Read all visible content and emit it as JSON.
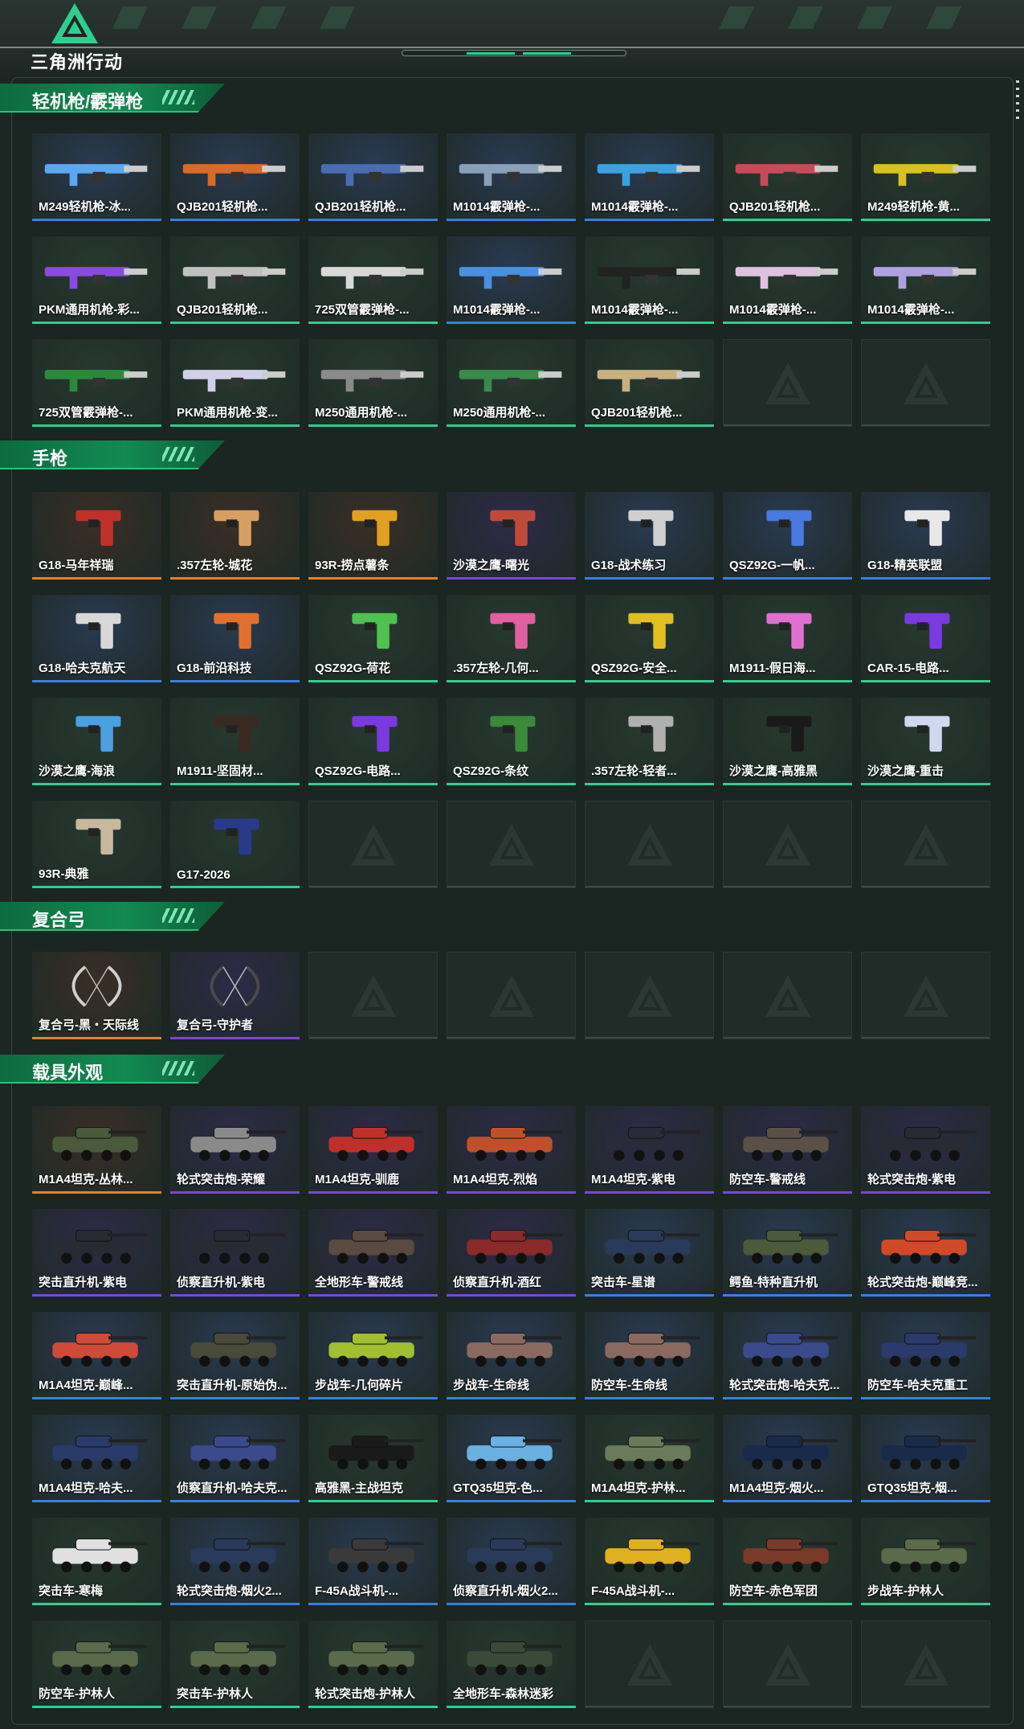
{
  "app": {
    "logo_text": "三角洲行动"
  },
  "colors": {
    "green": "#2ccf8f",
    "blue": "#3a7fe0",
    "purple": "#7a48d8",
    "orange": "#e8802a",
    "empty": "#3a4c45"
  },
  "sections": [
    {
      "title": "轻机枪/霰弹枪",
      "items": [
        {
          "label": "M249轻机枪-冰...",
          "rarity": "blue",
          "bg": "#2a3a52",
          "tint": "#5ba8f0"
        },
        {
          "label": "QJB201轻机枪...",
          "rarity": "blue",
          "bg": "#2a3a52",
          "tint": "#d86a2a"
        },
        {
          "label": "QJB201轻机枪...",
          "rarity": "blue",
          "bg": "#2a3a52",
          "tint": "#4a6db0"
        },
        {
          "label": "M1014霰弹枪-...",
          "rarity": "blue",
          "bg": "#2a3a52",
          "tint": "#8aa0b8"
        },
        {
          "label": "M1014霰弹枪-...",
          "rarity": "blue",
          "bg": "#2a3a52",
          "tint": "#3fa0e0"
        },
        {
          "label": "QJB201轻机枪...",
          "rarity": "green",
          "bg": "#27392f",
          "tint": "#c84a5a"
        },
        {
          "label": "M249轻机枪-黄...",
          "rarity": "green",
          "bg": "#27392f",
          "tint": "#d8c020"
        },
        {
          "label": "PKM通用机枪-彩...",
          "rarity": "green",
          "bg": "#27392f",
          "tint": "#8a4ae0"
        },
        {
          "label": "QJB201轻机枪...",
          "rarity": "green",
          "bg": "#27392f",
          "tint": "#c0c0c0"
        },
        {
          "label": "725双管霰弹枪-...",
          "rarity": "green",
          "bg": "#27392f",
          "tint": "#d8d8d8"
        },
        {
          "label": "M1014霰弹枪-...",
          "rarity": "blue",
          "bg": "#2a3a52",
          "tint": "#4a90e0"
        },
        {
          "label": "M1014霰弹枪-...",
          "rarity": "green",
          "bg": "#27392f",
          "tint": "#222222"
        },
        {
          "label": "M1014霰弹枪-...",
          "rarity": "green",
          "bg": "#27392f",
          "tint": "#e0c0e0"
        },
        {
          "label": "M1014霰弹枪-...",
          "rarity": "green",
          "bg": "#27392f",
          "tint": "#b0a0e0"
        },
        {
          "label": "725双管霰弹枪-...",
          "rarity": "green",
          "bg": "#27392f",
          "tint": "#2a8a3a"
        },
        {
          "label": "PKM通用机枪-变...",
          "rarity": "green",
          "bg": "#27392f",
          "tint": "#d0d0e8"
        },
        {
          "label": "M250通用机枪-...",
          "rarity": "green",
          "bg": "#27392f",
          "tint": "#8a8a8a"
        },
        {
          "label": "M250通用机枪-...",
          "rarity": "green",
          "bg": "#27392f",
          "tint": "#3a8a4a"
        },
        {
          "label": "QJB201轻机枪...",
          "rarity": "green",
          "bg": "#27392f",
          "tint": "#c8b080"
        },
        {
          "empty": true
        },
        {
          "empty": true
        }
      ]
    },
    {
      "title": "手枪",
      "items": [
        {
          "label": "G18-马年祥瑞",
          "rarity": "orange",
          "bg": "#3a2e26",
          "tint": "#c0302a"
        },
        {
          "label": ".357左轮-城花",
          "rarity": "orange",
          "bg": "#3a2e26",
          "tint": "#d8a060"
        },
        {
          "label": "93R-捞点薯条",
          "rarity": "orange",
          "bg": "#3a2e26",
          "tint": "#e0a020"
        },
        {
          "label": "沙漠之鹰-曙光",
          "rarity": "purple",
          "bg": "#2e2a48",
          "tint": "#c04a3a"
        },
        {
          "label": "G18-战术练习",
          "rarity": "blue",
          "bg": "#2a3a52",
          "tint": "#d0d0d0"
        },
        {
          "label": "QSZ92G-一帆...",
          "rarity": "blue",
          "bg": "#2a3a52",
          "tint": "#4a7ae0"
        },
        {
          "label": "G18-精英联盟",
          "rarity": "blue",
          "bg": "#2a3a52",
          "tint": "#e8e8e8"
        },
        {
          "label": "G18-哈夫克航天",
          "rarity": "blue",
          "bg": "#2a3a52",
          "tint": "#d8d8d8"
        },
        {
          "label": "G18-前沿科技",
          "rarity": "blue",
          "bg": "#2a3a52",
          "tint": "#e07030"
        },
        {
          "label": "QSZ92G-荷花",
          "rarity": "green",
          "bg": "#27392f",
          "tint": "#50c050"
        },
        {
          "label": ".357左轮-几何...",
          "rarity": "green",
          "bg": "#27392f",
          "tint": "#e060a0"
        },
        {
          "label": "QSZ92G-安全...",
          "rarity": "green",
          "bg": "#27392f",
          "tint": "#e0c020"
        },
        {
          "label": "M1911-假日海...",
          "rarity": "green",
          "bg": "#27392f",
          "tint": "#e070d0"
        },
        {
          "label": "CAR-15-电路...",
          "rarity": "green",
          "bg": "#27392f",
          "tint": "#7a3ae0"
        },
        {
          "label": "沙漠之鹰-海浪",
          "rarity": "green",
          "bg": "#27392f",
          "tint": "#4aa0e0"
        },
        {
          "label": "M1911-坚固材...",
          "rarity": "green",
          "bg": "#27392f",
          "tint": "#3a2a22"
        },
        {
          "label": "QSZ92G-电路...",
          "rarity": "green",
          "bg": "#27392f",
          "tint": "#7a3ae0"
        },
        {
          "label": "QSZ92G-条纹",
          "rarity": "green",
          "bg": "#27392f",
          "tint": "#3a8a3a"
        },
        {
          "label": ".357左轮-轻者...",
          "rarity": "green",
          "bg": "#27392f",
          "tint": "#b0b0b0"
        },
        {
          "label": "沙漠之鹰-高雅黑",
          "rarity": "green",
          "bg": "#27392f",
          "tint": "#1a1a1a"
        },
        {
          "label": "沙漠之鹰-重击",
          "rarity": "green",
          "bg": "#27392f",
          "tint": "#d0d8f0"
        },
        {
          "label": "93R-典雅",
          "rarity": "green",
          "bg": "#27392f",
          "tint": "#c8b8a0"
        },
        {
          "label": "G17-2026",
          "rarity": "green",
          "bg": "#27392f",
          "tint": "#2a3a8a"
        },
        {
          "empty": true
        },
        {
          "empty": true
        },
        {
          "empty": true
        },
        {
          "empty": true
        },
        {
          "empty": true
        }
      ]
    },
    {
      "title": "复合弓",
      "items": [
        {
          "label": "复合弓-黑・天际线",
          "rarity": "orange",
          "bg": "#3a2e26",
          "tint": "#d0d0d0"
        },
        {
          "label": "复合弓-守护者",
          "rarity": "purple",
          "bg": "#2e2a48",
          "tint": "#4a4a4a"
        },
        {
          "empty": true
        },
        {
          "empty": true
        },
        {
          "empty": true
        },
        {
          "empty": true
        },
        {
          "empty": true
        }
      ]
    },
    {
      "title": "载具外观",
      "items": [
        {
          "label": "M1A4坦克-丛林...",
          "rarity": "orange",
          "bg": "#3a2e26",
          "tint": "#4a5a3a"
        },
        {
          "label": "轮式突击炮-荣耀",
          "rarity": "purple",
          "bg": "#2e2a48",
          "tint": "#8a8a8a"
        },
        {
          "label": "M1A4坦克-驯鹿",
          "rarity": "purple",
          "bg": "#2e2a48",
          "tint": "#c0302a"
        },
        {
          "label": "M1A4坦克-烈焰",
          "rarity": "purple",
          "bg": "#2e2a48",
          "tint": "#c0502a"
        },
        {
          "label": "M1A4坦克-紫电",
          "rarity": "purple",
          "bg": "#2e2a48",
          "tint": "#2a2a3a"
        },
        {
          "label": "防空车-警戒线",
          "rarity": "purple",
          "bg": "#2e2a48",
          "tint": "#5a5048"
        },
        {
          "label": "轮式突击炮-紫电",
          "rarity": "purple",
          "bg": "#2e2a48",
          "tint": "#2a2a34"
        },
        {
          "label": "突击直升机-紫电",
          "rarity": "purple",
          "bg": "#2e2a48",
          "tint": "#2a2a34"
        },
        {
          "label": "侦察直升机-紫电",
          "rarity": "purple",
          "bg": "#2e2a48",
          "tint": "#2a2a34"
        },
        {
          "label": "全地形车-警戒线",
          "rarity": "purple",
          "bg": "#2e2a48",
          "tint": "#5a4a40"
        },
        {
          "label": "侦察直升机-酒红",
          "rarity": "purple",
          "bg": "#2e2a48",
          "tint": "#8a2a2a"
        },
        {
          "label": "突击车-星谱",
          "rarity": "blue",
          "bg": "#2a3a52",
          "tint": "#2a3a5a"
        },
        {
          "label": "鳄鱼-特种直升机",
          "rarity": "blue",
          "bg": "#2a3a52",
          "tint": "#4a5a3a"
        },
        {
          "label": "轮式突击炮-巅峰竞...",
          "rarity": "blue",
          "bg": "#2a3a52",
          "tint": "#d04a2a"
        },
        {
          "label": "M1A4坦克-巅峰...",
          "rarity": "blue",
          "bg": "#2a3a52",
          "tint": "#d04a3a"
        },
        {
          "label": "突击直升机-原始伪...",
          "rarity": "blue",
          "bg": "#2a3a52",
          "tint": "#4a4a3a"
        },
        {
          "label": "步战车-几何碎片",
          "rarity": "blue",
          "bg": "#2a3a52",
          "tint": "#a0c030"
        },
        {
          "label": "步战车-生命线",
          "rarity": "blue",
          "bg": "#2a3a52",
          "tint": "#8a6a60"
        },
        {
          "label": "防空车-生命线",
          "rarity": "blue",
          "bg": "#2a3a52",
          "tint": "#8a6a60"
        },
        {
          "label": "轮式突击炮-哈夫克...",
          "rarity": "blue",
          "bg": "#2a3a52",
          "tint": "#3a4a8a"
        },
        {
          "label": "防空车-哈夫克重工",
          "rarity": "blue",
          "bg": "#2a3a52",
          "tint": "#2a3a6a"
        },
        {
          "label": "M1A4坦克-哈夫...",
          "rarity": "blue",
          "bg": "#2a3a52",
          "tint": "#2a3a6a"
        },
        {
          "label": "侦察直升机-哈夫克...",
          "rarity": "blue",
          "bg": "#2a3a52",
          "tint": "#3a4a8a"
        },
        {
          "label": "高雅黑-主战坦克",
          "rarity": "green",
          "bg": "#27392f",
          "tint": "#1a1a1a"
        },
        {
          "label": "GTQ35坦克-色...",
          "rarity": "blue",
          "bg": "#2a3a52",
          "tint": "#6ab0e0"
        },
        {
          "label": "M1A4坦克-护林...",
          "rarity": "green",
          "bg": "#27392f",
          "tint": "#6a7a5a"
        },
        {
          "label": "M1A4坦克-烟火...",
          "rarity": "blue",
          "bg": "#2a3a52",
          "tint": "#1a2a4a"
        },
        {
          "label": "GTQ35坦克-烟...",
          "rarity": "blue",
          "bg": "#2a3a52",
          "tint": "#1a2a4a"
        },
        {
          "label": "突击车-寒梅",
          "rarity": "green",
          "bg": "#27392f",
          "tint": "#e0e0e0"
        },
        {
          "label": "轮式突击炮-烟火2...",
          "rarity": "blue",
          "bg": "#2a3a52",
          "tint": "#2a3a5a"
        },
        {
          "label": "F-45A战斗机-...",
          "rarity": "blue",
          "bg": "#2a3a52",
          "tint": "#3a3a3a"
        },
        {
          "label": "侦察直升机-烟火2...",
          "rarity": "blue",
          "bg": "#2a3a52",
          "tint": "#2a3a5a"
        },
        {
          "label": "F-45A战斗机-...",
          "rarity": "green",
          "bg": "#27392f",
          "tint": "#e0b020"
        },
        {
          "label": "防空车-赤色军团",
          "rarity": "green",
          "bg": "#27392f",
          "tint": "#7a3a2a"
        },
        {
          "label": "步战车-护林人",
          "rarity": "green",
          "bg": "#27392f",
          "tint": "#5a6a4a"
        },
        {
          "label": "防空车-护林人",
          "rarity": "green",
          "bg": "#27392f",
          "tint": "#5a6a4a"
        },
        {
          "label": "突击车-护林人",
          "rarity": "green",
          "bg": "#27392f",
          "tint": "#5a6a4a"
        },
        {
          "label": "轮式突击炮-护林人",
          "rarity": "green",
          "bg": "#27392f",
          "tint": "#5a6a4a"
        },
        {
          "label": "全地形车-森林迷彩",
          "rarity": "green",
          "bg": "#27392f",
          "tint": "#3a4a3a"
        },
        {
          "empty": true
        },
        {
          "empty": true
        },
        {
          "empty": true
        }
      ]
    }
  ]
}
